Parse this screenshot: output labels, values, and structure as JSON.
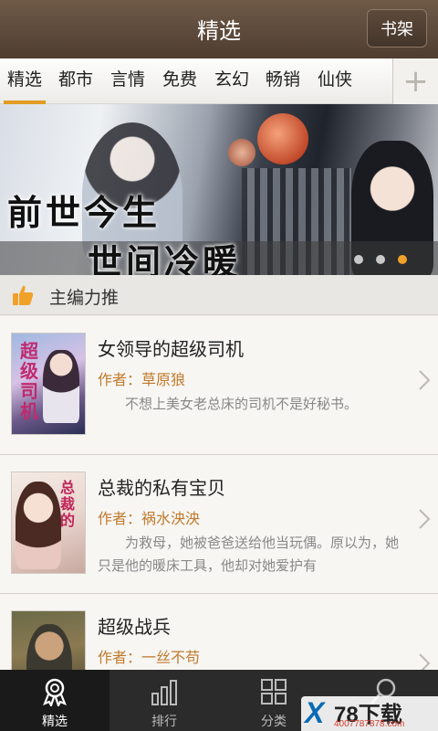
{
  "header": {
    "title": "精选",
    "shelf_label": "书架"
  },
  "tabs": [
    "精选",
    "都市",
    "言情",
    "免费",
    "玄幻",
    "畅销",
    "仙侠"
  ],
  "tabs_active_index": 0,
  "add_tab_icon": "plus-icon",
  "banner": {
    "line1": "前世今生",
    "line2": "世间冷暖",
    "dots_count": 3,
    "active_dot_index": 2
  },
  "section": {
    "title": "主编力推",
    "icon": "thumbs-up-icon"
  },
  "books": [
    {
      "title": "女领导的超级司机",
      "author": "作者：草原狼",
      "description": "不想上美女老总床的司机不是好秘书。",
      "cover_text": "超级司机"
    },
    {
      "title": "总裁的私有宝贝",
      "author": "作者：祸水泱泱",
      "description": "为救母，她被爸爸送给他当玩偶。原以为，她只是他的暖床工具，他却对她爱护有",
      "cover_text": "总裁的"
    },
    {
      "title": "超级战兵",
      "author": "作者：一丝不苟",
      "description": "",
      "cover_text": ""
    }
  ],
  "bottom_nav": [
    {
      "label": "精选",
      "icon": "medal-icon",
      "active": true
    },
    {
      "label": "排行",
      "icon": "bar-chart-icon",
      "active": false
    },
    {
      "label": "分类",
      "icon": "grid-icon",
      "active": false
    },
    {
      "label": "",
      "icon": "search-icon",
      "active": false
    }
  ],
  "watermark": {
    "brand": "78下载",
    "url": "4007787878.com"
  },
  "colors": {
    "accent": "#e39b22",
    "header_bg": "#5a4838",
    "author": "#c07a2c",
    "nav_bg": "#2b2b2b"
  }
}
